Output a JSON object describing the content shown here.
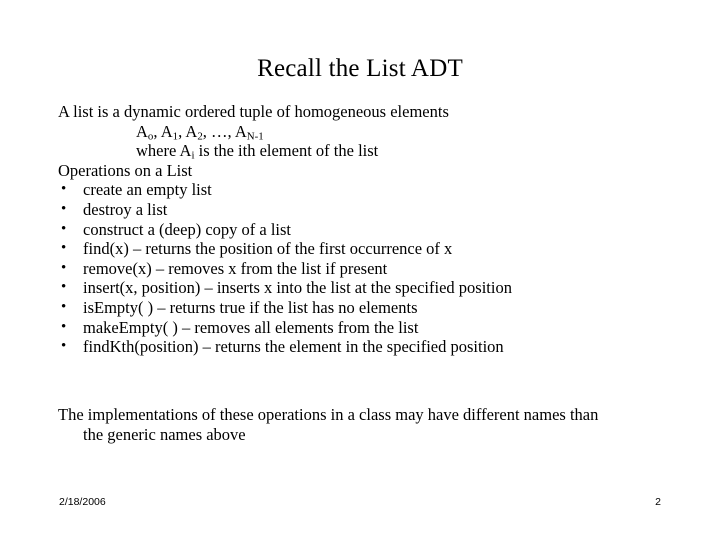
{
  "slide": {
    "title": "Recall the List ADT",
    "definition": {
      "line1": "A list is a dynamic ordered tuple of homogeneous elements",
      "sequence": {
        "a_letter": "A",
        "sub0": "o",
        "sep1": ", ",
        "sub1": "1",
        "sep2": ", ",
        "sub2": "2",
        "ellipsis": ", …, ",
        "subN": "N-1"
      },
      "where_prefix": "where A",
      "where_sub": "i",
      "where_suffix": " is the ith element of the list"
    },
    "operations_heading": "Operations on a List",
    "bullet_glyph": "•",
    "operations": [
      "create an empty list",
      "destroy a list",
      "construct a (deep) copy of a list",
      "find(x) – returns the position of the first occurrence of x",
      "remove(x) – removes x from the list if present",
      "insert(x, position) – inserts x into the list at the specified position",
      "isEmpty( ) – returns true if the list has no elements",
      "makeEmpty( ) – removes all elements from the list",
      "findKth(position) – returns the element in the specified position"
    ],
    "closing": {
      "line1": "The implementations of these operations in a class may have different names than",
      "line2": "the generic names above"
    },
    "footer": {
      "date": "2/18/2006",
      "page_number": "2"
    }
  }
}
